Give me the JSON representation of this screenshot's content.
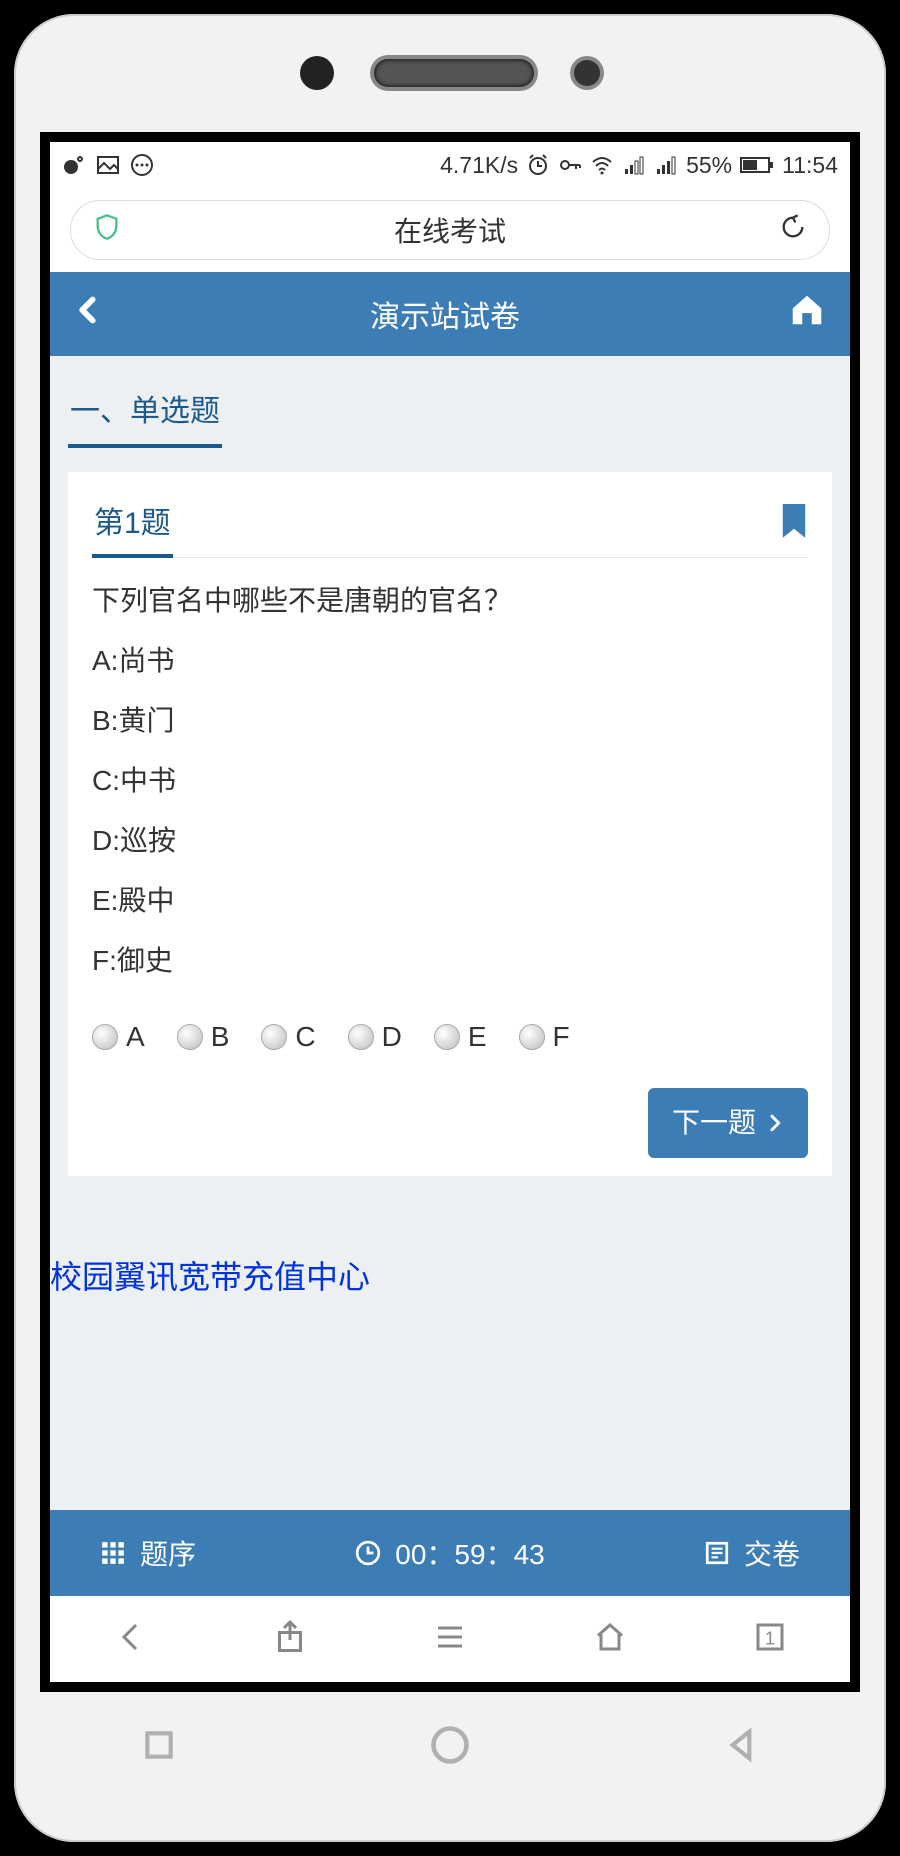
{
  "status": {
    "speed": "4.71K/s",
    "battery": "55%",
    "time": "11:54"
  },
  "browser": {
    "title": "在线考试",
    "tab_count": "1"
  },
  "header": {
    "title": "演示站试卷"
  },
  "section": {
    "label": "一、单选题"
  },
  "question": {
    "title": "第1题",
    "stem": "下列官名中哪些不是唐朝的官名？",
    "options": [
      "A:尚书",
      "B:黄门",
      "C:中书",
      "D:巡按",
      "E:殿中",
      "F:御史"
    ],
    "choices": [
      "A",
      "B",
      "C",
      "D",
      "E",
      "F"
    ],
    "next_label": "下一题"
  },
  "watermark": "校园翼讯宽带充值中心",
  "examFooter": {
    "order": "题序",
    "timer": "00：59：43",
    "submit": "交卷"
  }
}
